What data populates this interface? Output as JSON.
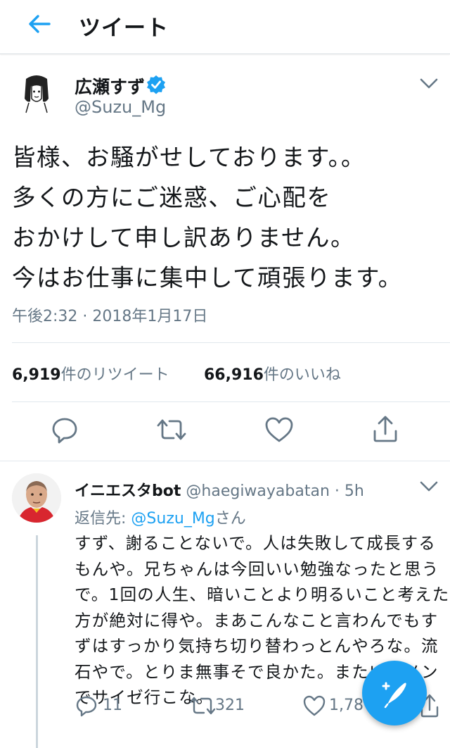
{
  "header": {
    "title": "ツイート",
    "back_icon": "arrow-left-icon"
  },
  "tweet": {
    "display_name": "広瀬すず",
    "handle": "@Suzu_Mg",
    "verified_icon": "verified-badge-icon",
    "lines": [
      "皆様、お騒がせしております。。",
      "多くの方にご迷惑、ご心配を",
      "おかけして申し訳ありません。",
      "今はお仕事に集中して頑張ります。"
    ],
    "timestamp": "午後2:32 · 2018年1月17日",
    "retweets": {
      "count": "6,919",
      "label": "件のリツイート"
    },
    "likes": {
      "count": "66,916",
      "label": "件のいいね"
    }
  },
  "reply": {
    "display_name": "イニエスタbot",
    "handle": "@haegiwayabatan",
    "time": "· 5h",
    "replying_prefix": "返信先:",
    "replying_handle": "@Suzu_Mg",
    "replying_suffix": "さん",
    "lines": [
      "すず、謝ることないで。人は失敗して成長する",
      "もんや。兄ちゃんは今回いい勉強なったと思う",
      "で。1回の人生、暗いことより明るいこと考えた",
      "方が絶対に得や。まあこんなこと言わんでもす",
      "ずはすっかり気持ち切り替わっとんやろな。流",
      "石やで。とりま無事そで良かた。またいつメン",
      "でサイゼ行こな。"
    ],
    "reply_count": "11",
    "retweet_count": "321",
    "like_count": "1,78"
  },
  "colors": {
    "accent": "#1da1f2",
    "muted": "#657786",
    "divider": "#e1e8ed"
  }
}
